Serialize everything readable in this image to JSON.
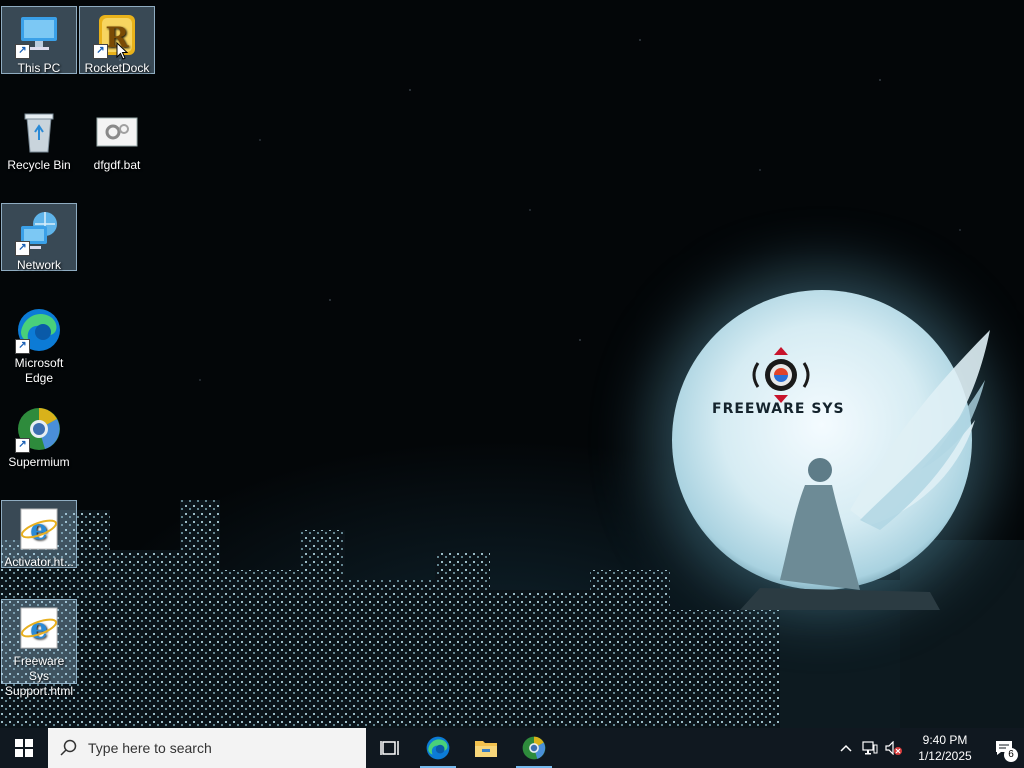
{
  "desktop": {
    "icons": [
      {
        "label": "This PC"
      },
      {
        "label": "RocketDock"
      },
      {
        "label": "Recycle Bin"
      },
      {
        "label": "dfgdf.bat"
      },
      {
        "label": "Network"
      },
      {
        "label": "Microsoft Edge"
      },
      {
        "label": "Supermium"
      },
      {
        "label": "Activator.ht..."
      },
      {
        "label": "Freeware Sys Support.html"
      }
    ]
  },
  "wallpaper": {
    "brand": "FREEWARE SYS"
  },
  "taskbar": {
    "search_placeholder": "Type here to search",
    "pinned": [
      "task-view-icon",
      "edge-icon",
      "file-explorer-icon",
      "supermium-icon"
    ],
    "clock_time": "9:40 PM",
    "clock_date": "1/12/2025",
    "notification_count": "6"
  },
  "colors": {
    "taskbar": "#101820",
    "accent": "#76b9ed"
  }
}
